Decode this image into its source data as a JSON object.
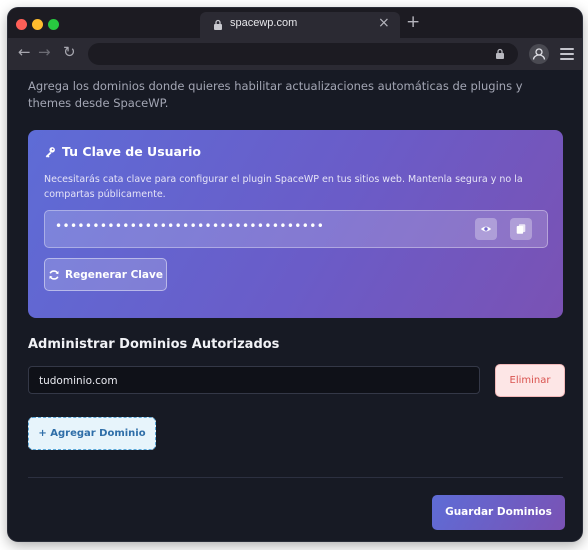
{
  "browser": {
    "tab_title": "spacewp.com",
    "tab_close": "×",
    "new_tab": "+",
    "nav_back": "←",
    "nav_forward": "→",
    "nav_reload": "↻"
  },
  "page": {
    "intro": "Agrega los dominios donde quieres habilitar actualizaciones automáticas de plugins y themes desde SpaceWP.",
    "key_card": {
      "title": "Tu Clave de Usuario",
      "description": "Necesitarás cata clave para configurar el plugin SpaceWP en tus sitios web. Mantenla segura y no la compartas públicamente.",
      "masked_key": "••••••••••••••••••••••••••••••••••••",
      "regenerate_label": "Regenerar Clave"
    },
    "domains": {
      "title": "Administrar Dominios Autorizados",
      "items": [
        {
          "value": "tudominio.com",
          "remove_label": "Eliminar"
        }
      ],
      "add_label": "+ Agregar Dominio",
      "save_label": "Guardar Dominios"
    }
  },
  "colors": {
    "accent_start": "#5e6cd6",
    "accent_end": "#7a52b4",
    "danger": "#d9534f",
    "link_blue": "#2f6ea8",
    "page_bg": "#171a24"
  },
  "icons": [
    "lock-icon",
    "key-icon",
    "eye-icon",
    "copy-icon",
    "refresh-icon",
    "account-icon",
    "menu-icon"
  ]
}
